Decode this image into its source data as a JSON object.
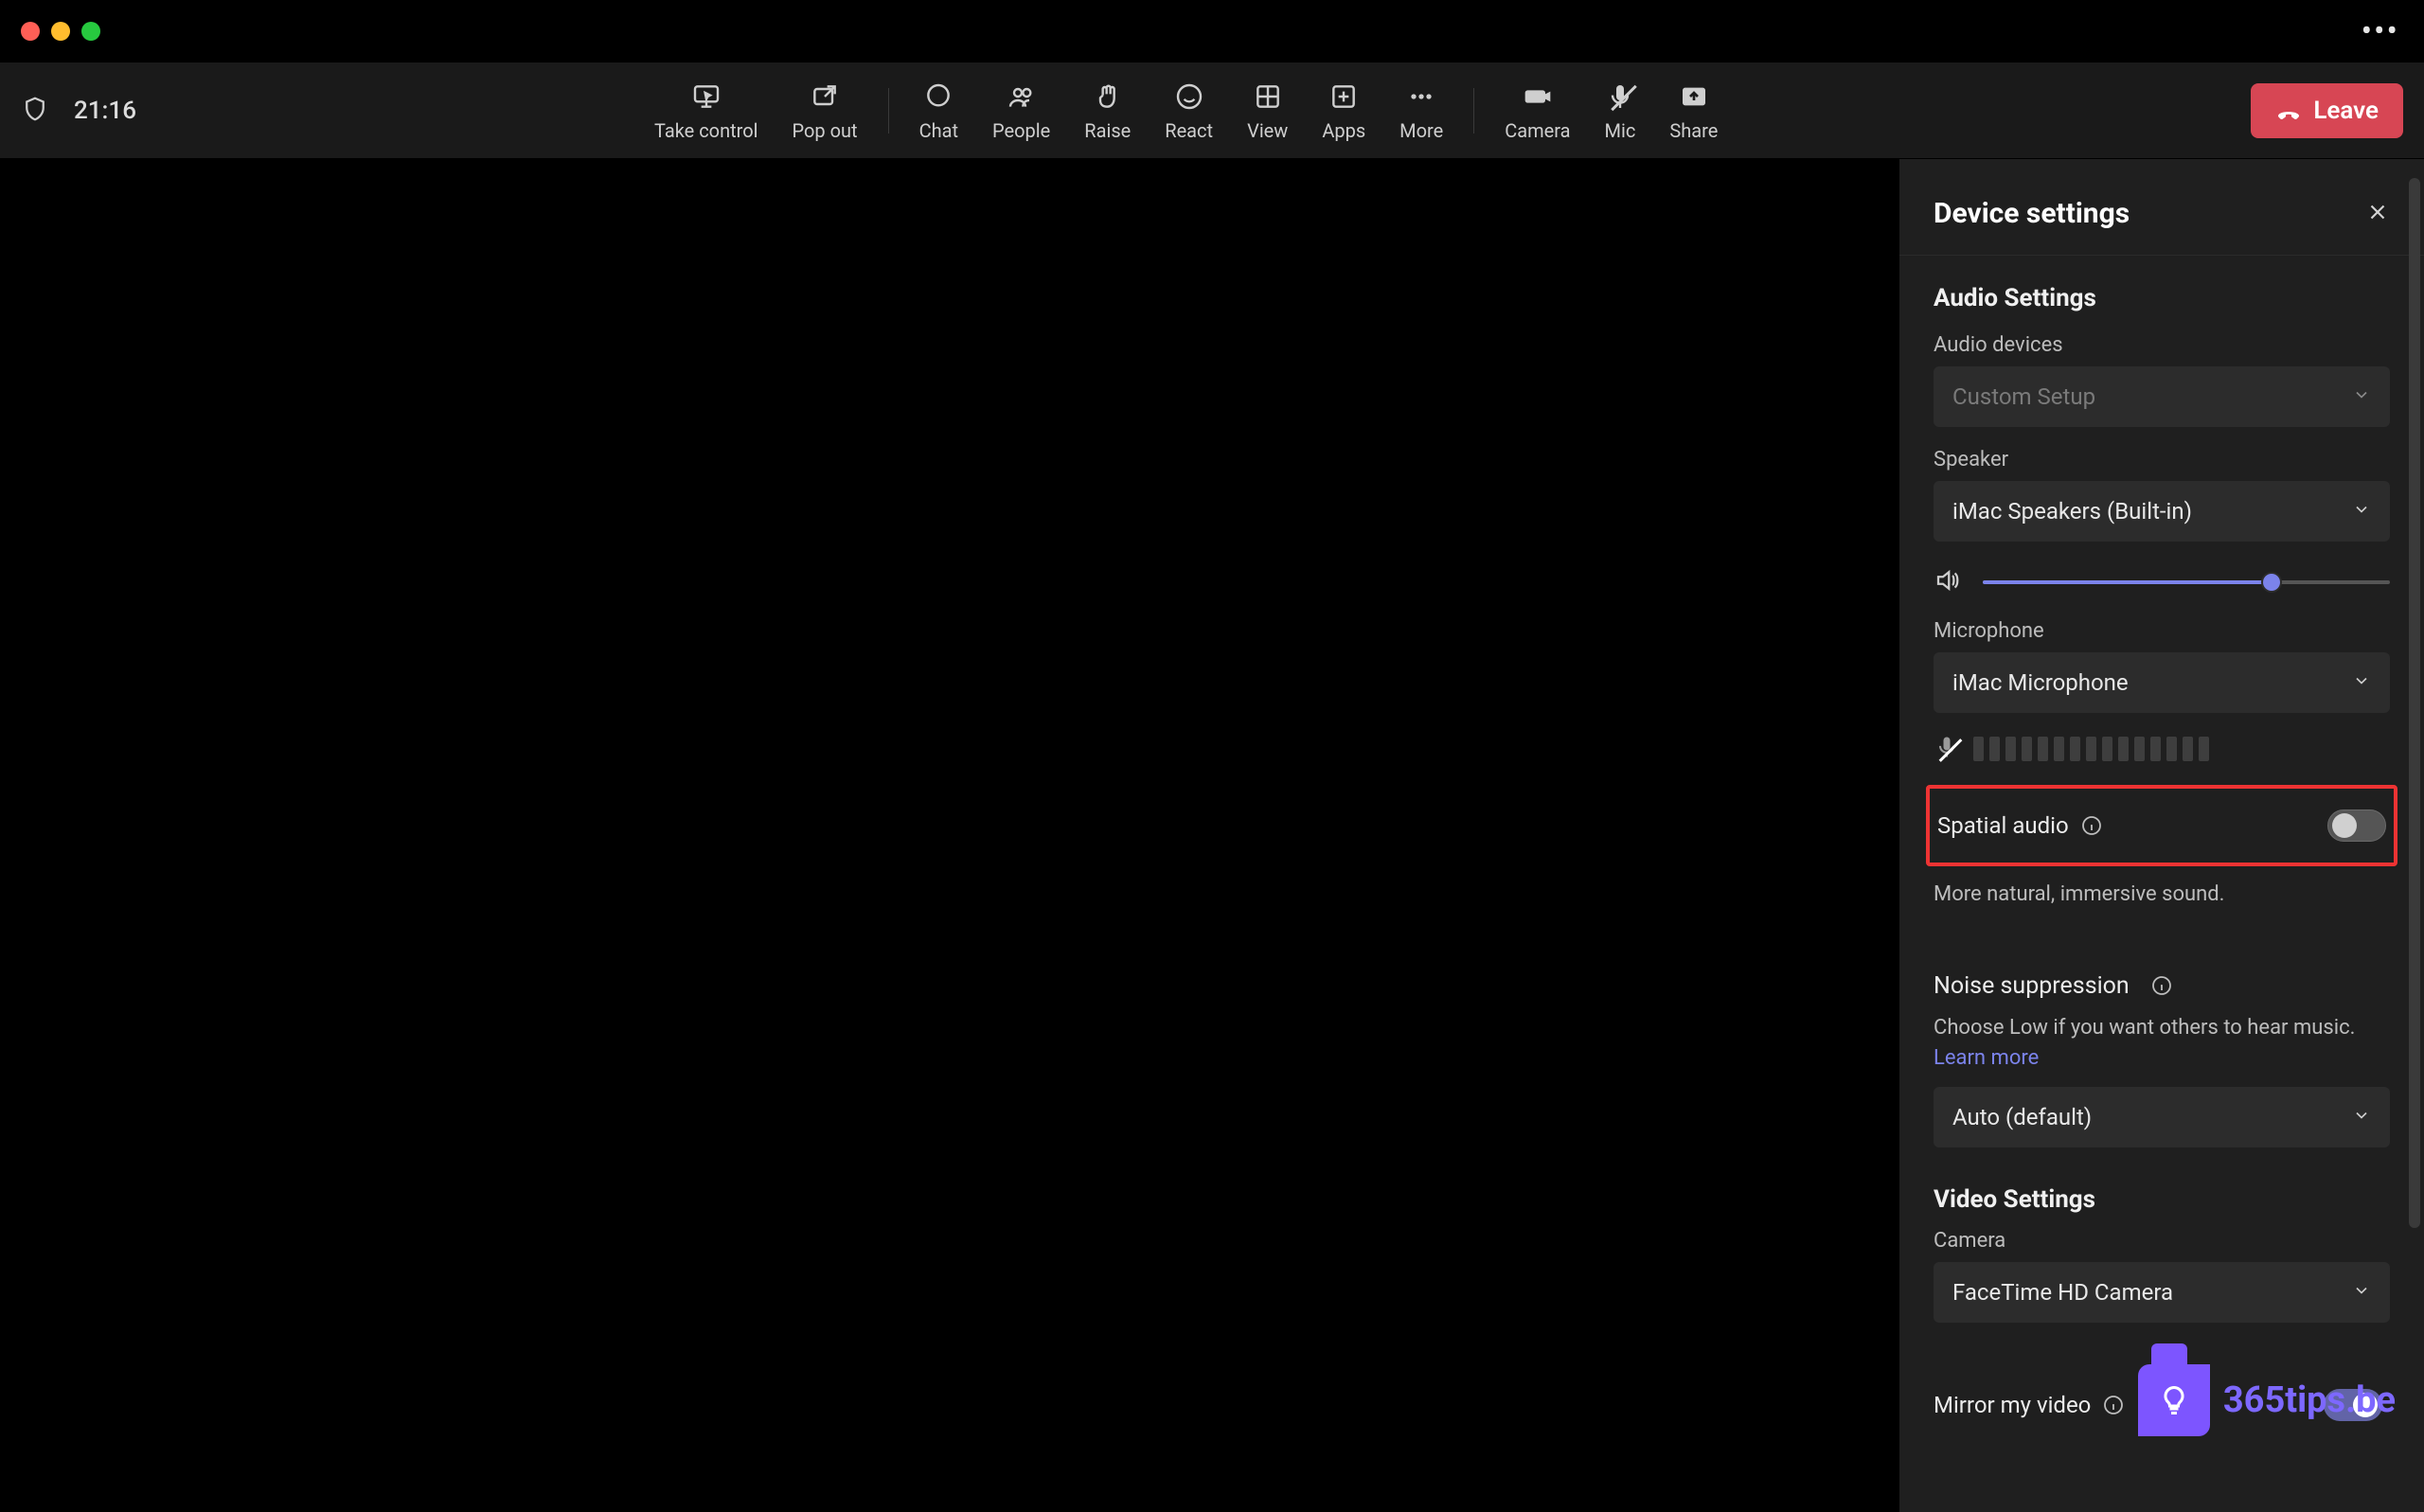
{
  "titlebar": {
    "more": "•••"
  },
  "toolbar": {
    "duration": "21:16",
    "take_control": "Take control",
    "pop_out": "Pop out",
    "chat": "Chat",
    "people": "People",
    "raise": "Raise",
    "react": "React",
    "view": "View",
    "apps": "Apps",
    "more": "More",
    "camera": "Camera",
    "mic": "Mic",
    "share": "Share",
    "leave": "Leave"
  },
  "panel": {
    "title": "Device settings",
    "audio": {
      "heading": "Audio Settings",
      "devices_label": "Audio devices",
      "devices_value": "Custom Setup",
      "speaker_label": "Speaker",
      "speaker_value": "iMac Speakers (Built-in)",
      "speaker_volume_pct": 71,
      "mic_label": "Microphone",
      "mic_value": "iMac Microphone",
      "spatial_label": "Spatial audio",
      "spatial_on": false,
      "spatial_desc": "More natural, immersive sound.",
      "noise_label": "Noise suppression",
      "noise_desc": "Choose Low if you want others to hear music. ",
      "noise_learn": "Learn more",
      "noise_value": "Auto (default)"
    },
    "video": {
      "heading": "Video Settings",
      "camera_label": "Camera",
      "camera_value": "FaceTime HD Camera",
      "mirror_label": "Mirror my video",
      "mirror_on": true
    }
  },
  "watermark": "365tips.be"
}
